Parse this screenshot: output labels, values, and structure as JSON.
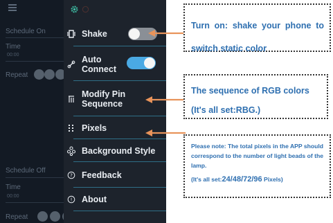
{
  "background_app": {
    "schedule_on_label": "Schedule On",
    "time_label_top": "Time",
    "time_value_top": "00:00",
    "repeat_label_top": "Repeat",
    "schedule_off_label": "Schedule Off",
    "time_label_bottom": "Time",
    "time_value_bottom": "00:00",
    "repeat_label_bottom": "Repeat"
  },
  "drawer": {
    "items": [
      {
        "label": "Shake",
        "icon": "shake-icon"
      },
      {
        "label": "Auto Connect",
        "icon": "link-icon"
      },
      {
        "label": "Modify Pin Sequence",
        "icon": "pin-icon"
      },
      {
        "label": "Pixels",
        "icon": "pixels-icon"
      },
      {
        "label": "Background Style",
        "icon": "palette-icon"
      },
      {
        "label": "Feedback",
        "icon": "question-icon"
      },
      {
        "label": "About",
        "icon": "info-icon"
      }
    ],
    "toggles": {
      "shake": {
        "on": false
      },
      "auto_connect": {
        "on": true
      }
    }
  },
  "annotations": {
    "note1": "Turn on: shake your phone to switch static color",
    "note2_line1": "The sequence of RGB colors",
    "note2_line2": "(It's all set:RBG.)",
    "note3_text": "Please note: The total pixels in the APP should correspond to the number of light beads of the lamp.",
    "note3_prefix": "(It's all set:",
    "note3_values": "24/48/72/96",
    "note3_suffix": " Pixels)"
  },
  "colors": {
    "toggle_on": "#4aa9e3",
    "toggle_off": "#8a8f96",
    "separator": "#2f6f88",
    "arrow": "#e8935a",
    "note_text": "#2e6fb0",
    "gear_accent": "#3fbfa6"
  }
}
